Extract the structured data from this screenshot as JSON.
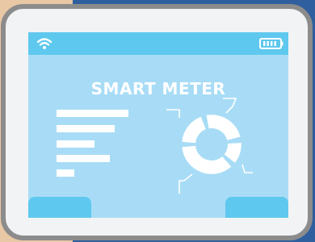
{
  "colors": {
    "background_blue": "#2f5f9e",
    "background_cream": "#e9c8a6",
    "screen_fill": "#a8dcf6",
    "status_bar": "#5ec8ee",
    "device_bezel": "#8c8c8c"
  },
  "icons": {
    "wifi": "wifi-icon",
    "battery": "battery-icon",
    "donut": "donut-chart-icon"
  },
  "screen": {
    "title": "SMART METER"
  }
}
